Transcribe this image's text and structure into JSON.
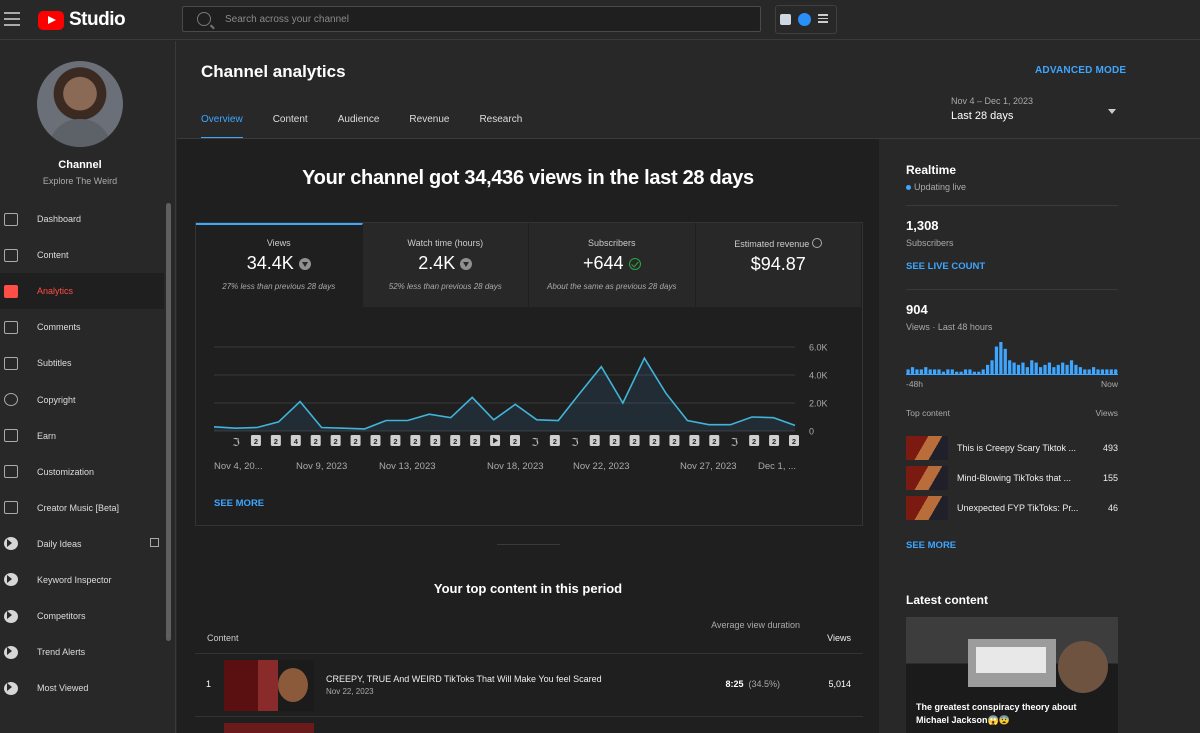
{
  "topbar": {
    "brand": "Studio",
    "search_placeholder": "Search across your channel"
  },
  "sidebar": {
    "channel_label": "Channel",
    "channel_name": "Explore The Weird",
    "items": [
      {
        "label": "Dashboard",
        "icon": "dashboard-icon"
      },
      {
        "label": "Content",
        "icon": "content-icon"
      },
      {
        "label": "Analytics",
        "icon": "analytics-icon",
        "active": true
      },
      {
        "label": "Comments",
        "icon": "comments-icon"
      },
      {
        "label": "Subtitles",
        "icon": "subtitles-icon"
      },
      {
        "label": "Copyright",
        "icon": "copyright-icon"
      },
      {
        "label": "Earn",
        "icon": "earn-icon"
      },
      {
        "label": "Customization",
        "icon": "customization-icon"
      },
      {
        "label": "Creator Music [Beta]",
        "icon": "creator-music-icon"
      },
      {
        "label": "Daily Ideas",
        "icon": "extension-icon"
      },
      {
        "label": "Keyword Inspector",
        "icon": "extension-icon"
      },
      {
        "label": "Competitors",
        "icon": "extension-icon"
      },
      {
        "label": "Trend Alerts",
        "icon": "extension-icon"
      },
      {
        "label": "Most Viewed",
        "icon": "extension-icon"
      }
    ]
  },
  "header": {
    "title": "Channel analytics",
    "advanced_mode": "ADVANCED MODE",
    "tabs": [
      "Overview",
      "Content",
      "Audience",
      "Revenue",
      "Research"
    ],
    "active_tab": "Overview",
    "date_range": "Nov 4 – Dec 1, 2023",
    "period": "Last 28 days"
  },
  "overview": {
    "headline": "Your channel got 34,436 views in the last 28 days",
    "metrics": [
      {
        "label": "Views",
        "value": "34.4K",
        "note": "27% less than previous 28 days",
        "badge": "down"
      },
      {
        "label": "Watch time (hours)",
        "value": "2.4K",
        "note": "52% less than previous 28 days",
        "badge": "down"
      },
      {
        "label": "Subscribers",
        "value": "+644",
        "note": "About the same as previous 28 days",
        "badge": "ok"
      },
      {
        "label": "Estimated revenue",
        "value": "$94.87",
        "note": "",
        "badge": "none"
      }
    ],
    "see_more": "SEE MORE"
  },
  "chart_data": {
    "type": "area",
    "x": [
      "Nov 4",
      "Nov 5",
      "Nov 6",
      "Nov 7",
      "Nov 8",
      "Nov 9",
      "Nov 10",
      "Nov 11",
      "Nov 12",
      "Nov 13",
      "Nov 14",
      "Nov 15",
      "Nov 16",
      "Nov 17",
      "Nov 18",
      "Nov 19",
      "Nov 20",
      "Nov 21",
      "Nov 22",
      "Nov 23",
      "Nov 24",
      "Nov 25",
      "Nov 26",
      "Nov 27",
      "Nov 28",
      "Nov 29",
      "Nov 30",
      "Dec 1"
    ],
    "values": [
      300,
      200,
      250,
      650,
      2100,
      250,
      200,
      150,
      750,
      750,
      1200,
      950,
      2400,
      800,
      1900,
      800,
      750,
      2700,
      4600,
      2000,
      5200,
      2700,
      750,
      450,
      450,
      1000,
      950,
      400
    ],
    "x_tick_labels": [
      "Nov 4, 20...",
      "Nov 9, 2023",
      "Nov 13, 2023",
      "Nov 18, 2023",
      "Nov 22, 2023",
      "Nov 27, 2023",
      "Dec 1, ..."
    ],
    "y_tick_labels": [
      "0",
      "2.0K",
      "4.0K",
      "6.0K"
    ],
    "ylim": [
      0,
      6000
    ],
    "grid": true,
    "upload_markers": [
      "shorts",
      "2",
      "2",
      "4",
      "2",
      "2",
      "2",
      "2",
      "2",
      "2",
      "2",
      "2",
      "2",
      "play",
      "2",
      "shorts",
      "2",
      "shorts",
      "2",
      "2",
      "2",
      "2",
      "2",
      "2",
      "2",
      "shorts",
      "2",
      "2",
      "2"
    ]
  },
  "top_content": {
    "title": "Your top content in this period",
    "col_content": "Content",
    "col_avd": "Average view duration",
    "col_views": "Views",
    "rows": [
      {
        "rank": "1",
        "title": "CREEPY, TRUE And WEIRD TikToks That Will Make You feel Scared",
        "date": "Nov 22, 2023",
        "duration": "8:25",
        "pct": "(34.5%)",
        "views": "5,014"
      }
    ]
  },
  "realtime": {
    "title": "Realtime",
    "status": "Updating live",
    "subscribers": "1,308",
    "subscribers_label": "Subscribers",
    "live_count": "SEE LIVE COUNT",
    "views": "904",
    "views_label": "Views · Last 48 hours",
    "axis_left": "-48h",
    "axis_right": "Now",
    "top_content_label": "Top content",
    "views_col": "Views",
    "bars": [
      2,
      3,
      2,
      2,
      3,
      2,
      2,
      2,
      1,
      2,
      2,
      1,
      1,
      2,
      2,
      1,
      1,
      2,
      4,
      6,
      12,
      14,
      11,
      6,
      5,
      4,
      5,
      3,
      6,
      5,
      3,
      4,
      5,
      3,
      4,
      5,
      4,
      6,
      4,
      3,
      2,
      2,
      3,
      2,
      2,
      2,
      2,
      2
    ],
    "items": [
      {
        "title": "This is Creepy Scary Tiktok ...",
        "views": "493"
      },
      {
        "title": "Mind-Blowing TikToks that ...",
        "views": "155"
      },
      {
        "title": "Unexpected FYP TikToks: Pr...",
        "views": "46"
      }
    ],
    "see_more": "SEE MORE"
  },
  "latest": {
    "title": "Latest content",
    "video_title": "The greatest conspiracy theory about Michael Jackson😱😨"
  }
}
